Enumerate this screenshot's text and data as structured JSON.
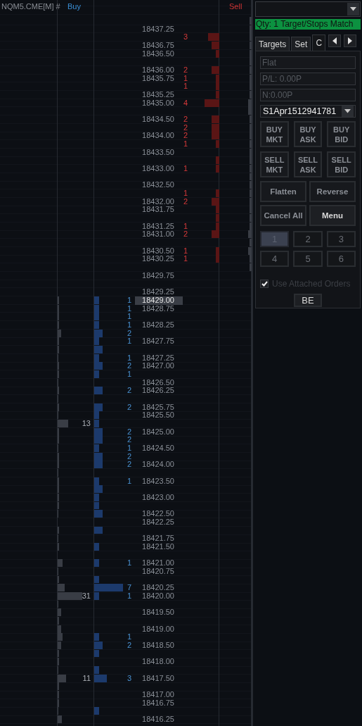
{
  "ladder": {
    "header": {
      "symbol": "NQM5.CME[M] #",
      "buy_label": "Buy",
      "sell_label": "Sell"
    },
    "rows": [
      {
        "current": false
      },
      {
        "price": "18437.25",
        "current": false
      },
      {
        "current": false,
        "ask_size": "3"
      },
      {
        "price": "18436.75",
        "current": false
      },
      {
        "price": "18436.50",
        "current": false
      },
      {
        "current": false
      },
      {
        "price": "18436.00",
        "current": false,
        "ask_size": "2"
      },
      {
        "price": "18435.75",
        "current": false,
        "ask_size": "1"
      },
      {
        "current": false,
        "ask_size": "1"
      },
      {
        "price": "18435.25",
        "current": false
      },
      {
        "price": "18435.00",
        "current": false,
        "ask_size": "4"
      },
      {
        "current": false
      },
      {
        "price": "18434.50",
        "current": false,
        "ask_size": "2"
      },
      {
        "current": false,
        "ask_size": "2"
      },
      {
        "price": "18434.00",
        "current": false,
        "ask_size": "2"
      },
      {
        "current": false,
        "ask_size": "1"
      },
      {
        "price": "18433.50",
        "current": false
      },
      {
        "current": false
      },
      {
        "price": "18433.00",
        "current": false,
        "ask_size": "1"
      },
      {
        "current": false
      },
      {
        "price": "18432.50",
        "current": false
      },
      {
        "current": false,
        "ask_size": "1"
      },
      {
        "price": "18432.00",
        "current": false,
        "ask_size": "2"
      },
      {
        "price": "18431.75",
        "current": false
      },
      {
        "current": false
      },
      {
        "price": "18431.25",
        "current": false,
        "ask_size": "1"
      },
      {
        "price": "18431.00",
        "current": false,
        "ask_size": "2"
      },
      {
        "current": false
      },
      {
        "price": "18430.50",
        "current": false,
        "ask_size": "1"
      },
      {
        "price": "18430.25",
        "current": false,
        "ask_size": "1"
      },
      {
        "current": false
      },
      {
        "price": "18429.75",
        "current": false
      },
      {
        "current": false
      },
      {
        "price": "18429.25",
        "current": false
      },
      {
        "price": "18429.00",
        "current": true,
        "bid_size": "1"
      },
      {
        "price": "18428.75",
        "current": false,
        "bid_size": "1"
      },
      {
        "current": false,
        "bid_size": "1"
      },
      {
        "price": "18428.25",
        "current": false,
        "bid_size": "1"
      },
      {
        "current": false,
        "bid_size": "2"
      },
      {
        "price": "18427.75",
        "current": false,
        "bid_size": "1"
      },
      {
        "current": false
      },
      {
        "price": "18427.25",
        "current": false,
        "bid_size": "1"
      },
      {
        "price": "18427.00",
        "current": false,
        "bid_size": "2"
      },
      {
        "current": false,
        "bid_size": "1"
      },
      {
        "price": "18426.50",
        "current": false
      },
      {
        "price": "18426.25",
        "current": false,
        "bid_size": "2"
      },
      {
        "current": false
      },
      {
        "price": "18425.75",
        "current": false,
        "bid_size": "2"
      },
      {
        "price": "18425.50",
        "current": false
      },
      {
        "current": false,
        "volume": "13"
      },
      {
        "price": "18425.00",
        "current": false,
        "bid_size": "2"
      },
      {
        "current": false,
        "bid_size": "2"
      },
      {
        "price": "18424.50",
        "current": false,
        "bid_size": "1"
      },
      {
        "current": false,
        "bid_size": "2"
      },
      {
        "price": "18424.00",
        "current": false,
        "bid_size": "2"
      },
      {
        "current": false
      },
      {
        "price": "18423.50",
        "current": false,
        "bid_size": "1"
      },
      {
        "current": false
      },
      {
        "price": "18423.00",
        "current": false
      },
      {
        "current": false
      },
      {
        "price": "18422.50",
        "current": false
      },
      {
        "price": "18422.25",
        "current": false
      },
      {
        "current": false
      },
      {
        "price": "18421.75",
        "current": false
      },
      {
        "price": "18421.50",
        "current": false
      },
      {
        "current": false
      },
      {
        "price": "18421.00",
        "current": false,
        "bid_size": "1"
      },
      {
        "price": "18420.75",
        "current": false
      },
      {
        "current": false
      },
      {
        "price": "18420.25",
        "current": false,
        "bid_size": "7"
      },
      {
        "price": "18420.00",
        "current": false,
        "bid_size": "1",
        "volume": "31"
      },
      {
        "current": false
      },
      {
        "price": "18419.50",
        "current": false
      },
      {
        "current": false
      },
      {
        "price": "18419.00",
        "current": false
      },
      {
        "current": false,
        "bid_size": "1"
      },
      {
        "price": "18418.50",
        "current": false,
        "bid_size": "2"
      },
      {
        "current": false
      },
      {
        "price": "18418.00",
        "current": false
      },
      {
        "current": false
      },
      {
        "price": "18417.50",
        "current": false,
        "bid_size": "3",
        "volume": "11"
      },
      {
        "current": false
      },
      {
        "price": "18417.00",
        "current": false
      },
      {
        "price": "18416.75",
        "current": false
      },
      {
        "current": false
      },
      {
        "price": "18416.25",
        "current": false
      }
    ]
  },
  "order_panel": {
    "status": "Qty: 1 Target/Stops Match",
    "tabs": [
      {
        "label": "Targets",
        "selected": false
      },
      {
        "label": "Set",
        "selected": false
      },
      {
        "label": "C",
        "selected": true
      }
    ],
    "fields": [
      {
        "value": "Flat",
        "disabled": true
      },
      {
        "value": "P/L: 0.00P",
        "disabled": true
      },
      {
        "value": "N:0.00P",
        "disabled": true
      }
    ],
    "account": "S1Apr1512941781",
    "order_buttons": [
      {
        "label": "BUY MKT"
      },
      {
        "label": "BUY ASK"
      },
      {
        "label": "BUY BID"
      },
      {
        "label": "SELL MKT"
      },
      {
        "label": "SELL ASK"
      },
      {
        "label": "SELL BID"
      }
    ],
    "actions": [
      {
        "label": "Flatten",
        "kind": "normal"
      },
      {
        "label": "Reverse",
        "kind": "normal"
      },
      {
        "label": "Cancel All",
        "kind": "normal"
      },
      {
        "label": "Menu",
        "kind": "default"
      }
    ],
    "quantity_buttons": [
      {
        "label": "1",
        "selected": true
      },
      {
        "label": "2",
        "selected": false
      },
      {
        "label": "3",
        "selected": false
      },
      {
        "label": "4",
        "selected": false
      },
      {
        "label": "5",
        "selected": false
      },
      {
        "label": "6",
        "selected": false
      }
    ],
    "attached_orders": {
      "label": "Use Attached Orders",
      "checked": true,
      "disabled": true
    },
    "be_button": "BE"
  }
}
